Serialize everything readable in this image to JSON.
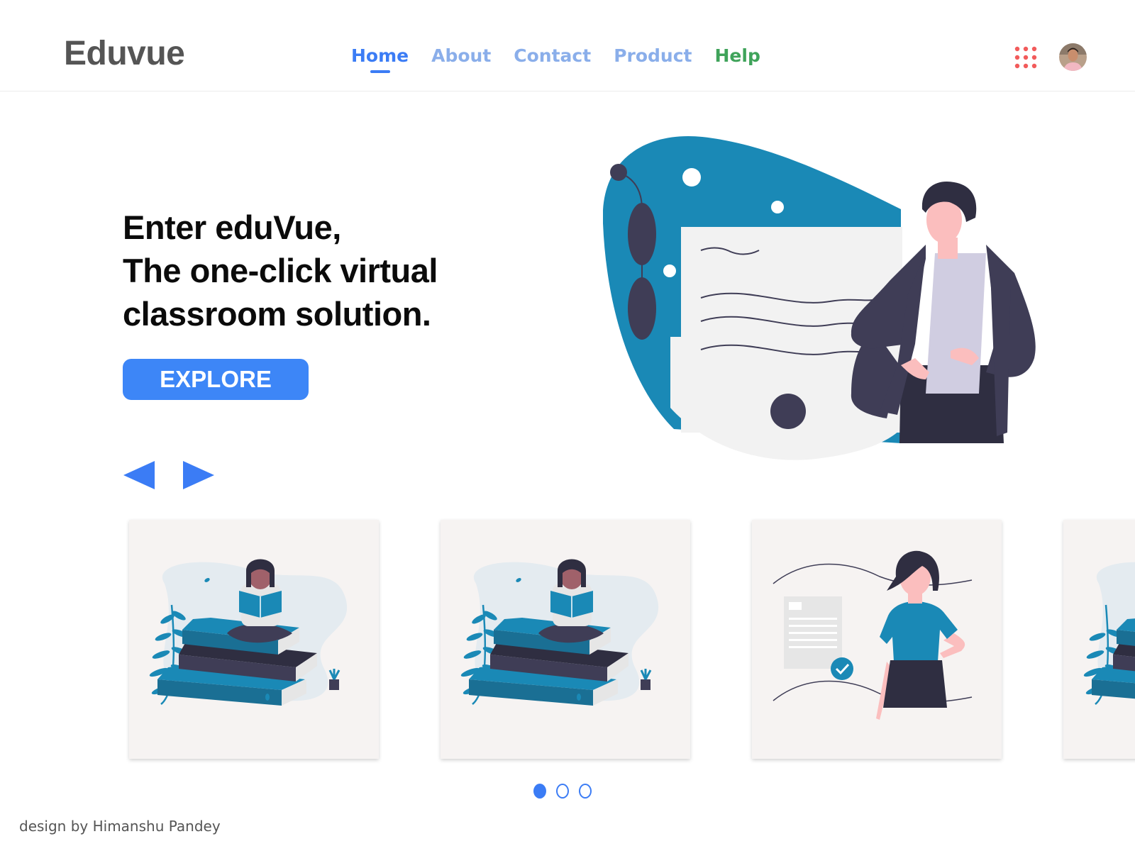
{
  "header": {
    "brand": "Eduvue",
    "nav": [
      {
        "label": "Home",
        "state": "active"
      },
      {
        "label": "About",
        "state": "default"
      },
      {
        "label": "Contact",
        "state": "default"
      },
      {
        "label": "Product",
        "state": "default"
      },
      {
        "label": "Help",
        "state": "default"
      }
    ],
    "apps_icon": "grid-dots-icon",
    "avatar_icon": "user-avatar"
  },
  "hero": {
    "title_lines": [
      "Enter eduVue,",
      "The one-click virtual",
      "classroom solution."
    ],
    "cta_label": "EXPLORE",
    "prev_icon": "triangle-left-icon",
    "next_icon": "triangle-right-icon",
    "illustration": "teacher-with-whiteboard"
  },
  "carousel": {
    "cards": [
      {
        "illustration": "girl-reading-on-books"
      },
      {
        "illustration": "girl-reading-on-books"
      },
      {
        "illustration": "woman-with-checked-document"
      },
      {
        "illustration": "girl-reading-on-books"
      }
    ],
    "pages": 3,
    "active_page": 1
  },
  "footer": {
    "credit": "design by Himanshu Pandey"
  },
  "colors": {
    "accent": "#3b7cf5",
    "nav_inactive": "#8aaeea",
    "help": "#3fa35a",
    "apps_icon": "#f25b5b",
    "illustration_blue": "#1a89b6",
    "illustration_dark": "#3f3d56"
  }
}
